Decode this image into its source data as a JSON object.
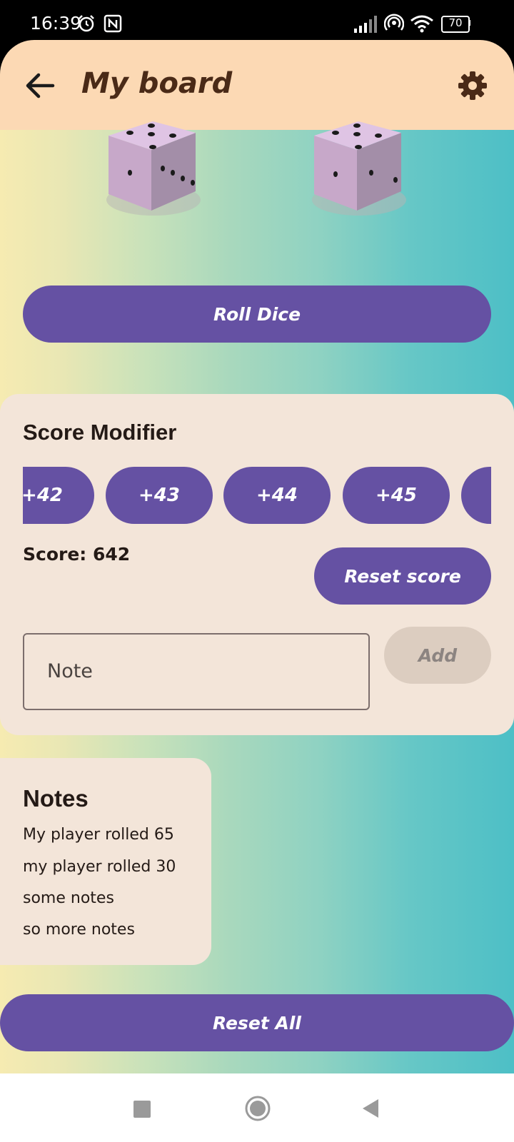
{
  "status_bar": {
    "time": "16:39",
    "battery": "70",
    "icons": [
      "alarm-icon",
      "nfc-icon",
      "signal-icon",
      "hotspot-icon",
      "wifi-icon",
      "battery-icon"
    ]
  },
  "app_bar": {
    "title": "My board",
    "back_icon": "arrow-left-icon",
    "settings_icon": "gear-icon"
  },
  "dice": [
    {
      "top_pips": 5,
      "right_pips": 4
    },
    {
      "top_pips": 5,
      "right_pips": 3
    }
  ],
  "roll_button": {
    "label": "Roll Dice"
  },
  "score_card": {
    "title": "Score Modifier",
    "chips": [
      "+42",
      "+43",
      "+44",
      "+45",
      ""
    ],
    "score_label": "Score: 642",
    "reset_score_label": "Reset score",
    "note_placeholder": "Note",
    "add_label": "Add"
  },
  "notes": {
    "title": "Notes",
    "items": [
      "My player rolled 65",
      "my player rolled 30",
      "some notes",
      "so more notes"
    ]
  },
  "reset_all": {
    "label": "Reset All"
  },
  "colors": {
    "accent": "#6551a3",
    "app_bar": "#fcd9b4",
    "card": "#f3e5d9",
    "title_text": "#4a2a17"
  }
}
